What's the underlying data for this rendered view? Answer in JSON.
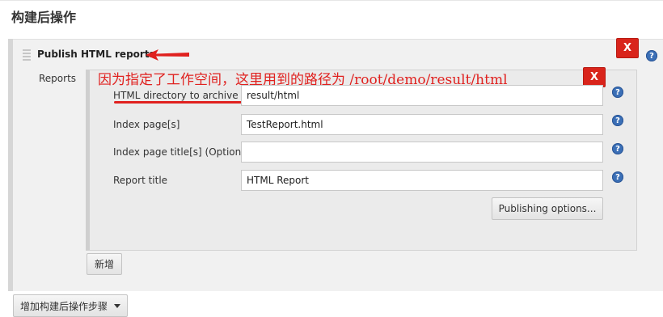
{
  "section": {
    "title": "构建后操作"
  },
  "step": {
    "title": "Publish HTML reports",
    "delete_label": "X",
    "reports_label": "Reports"
  },
  "annotation": {
    "text": "因为指定了工作空间，这里用到的路径为 /root/demo/result/html"
  },
  "report": {
    "delete_label": "X",
    "fields": [
      {
        "label": "HTML directory to archive",
        "value": "result/html"
      },
      {
        "label": "Index page[s]",
        "value": "TestReport.html"
      },
      {
        "label": "Index page title[s] (Optional)",
        "value": ""
      },
      {
        "label": "Report title",
        "value": "HTML Report"
      }
    ],
    "publishing_options_label": "Publishing options..."
  },
  "add_button_label": "新增",
  "add_step_button_label": "增加构建后操作步骤",
  "help_glyph": "?",
  "colors": {
    "delete_red": "#d9241b",
    "annotation_red": "#e0211f",
    "help_blue": "#3b6fb6"
  }
}
